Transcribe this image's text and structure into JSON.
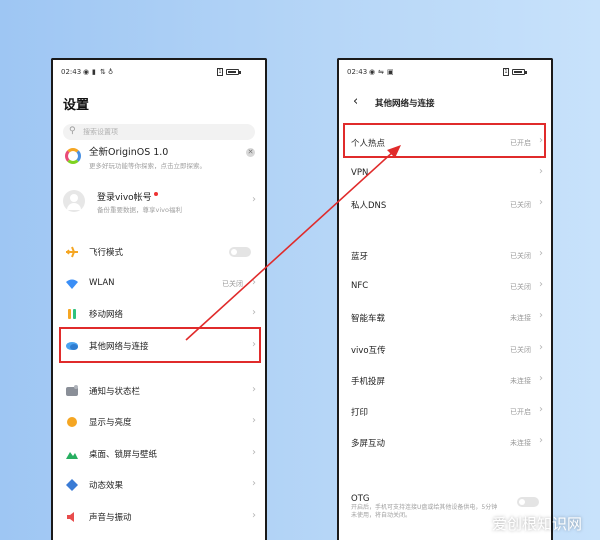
{
  "left": {
    "status": {
      "time": "02:43",
      "icons": [
        "eye-icon",
        "signal-icon",
        "data-icon",
        "location-icon"
      ],
      "battery": "battery-icon"
    },
    "title": "设置",
    "search_placeholder": "搜索设置项",
    "update": {
      "title": "全新OriginOS 1.0",
      "subtitle": "更多好玩功能等你探索，点击立即探索。"
    },
    "account": {
      "name": "登录vivo帐号",
      "sub": "备份重要数据，尊享vivo福利"
    },
    "items": [
      {
        "label": "飞行模式",
        "value": "",
        "icon": "airplane-icon",
        "color": "#f5a623"
      },
      {
        "label": "WLAN",
        "value": "已关闭",
        "icon": "wifi-icon",
        "color": "#3a8ef6"
      },
      {
        "label": "移动网络",
        "value": "",
        "icon": "cellular-icon",
        "color": "#2ec27e"
      },
      {
        "label": "其他网络与连接",
        "value": "",
        "icon": "connection-icon",
        "color": "#4aa3f0"
      },
      {
        "label": "通知与状态栏",
        "value": "",
        "icon": "notification-icon",
        "color": "#8a8f98"
      },
      {
        "label": "显示与亮度",
        "value": "",
        "icon": "brightness-icon",
        "color": "#f5a623"
      },
      {
        "label": "桌面、锁屏与壁纸",
        "value": "",
        "icon": "wallpaper-icon",
        "color": "#27ae60"
      },
      {
        "label": "动态效果",
        "value": "",
        "icon": "dynamic-effect-icon",
        "color": "#3a7bd5"
      },
      {
        "label": "声音与振动",
        "value": "",
        "icon": "sound-icon",
        "color": "#e84c4c"
      }
    ]
  },
  "right": {
    "status": {
      "time": "02:43",
      "icons": [
        "eye-icon",
        "signal-icon",
        "data-icon"
      ],
      "battery": "battery-icon"
    },
    "title": "其他网络与连接",
    "items": [
      {
        "label": "个人热点",
        "value": "已开启"
      },
      {
        "label": "VPN",
        "value": ""
      },
      {
        "label": "私人DNS",
        "value": "已关闭"
      },
      {
        "label": "蓝牙",
        "value": "已关闭"
      },
      {
        "label": "NFC",
        "value": "已关闭"
      },
      {
        "label": "智能车载",
        "value": "未连接"
      },
      {
        "label": "vivo互传",
        "value": "已关闭"
      },
      {
        "label": "手机投屏",
        "value": "未连接"
      },
      {
        "label": "打印",
        "value": "已开启"
      },
      {
        "label": "多屏互动",
        "value": "未连接"
      }
    ],
    "otg": {
      "label": "OTG",
      "sub": "开启后，手机可支持连接U盘或给其他设备供电，5分钟未使用，将自动关闭。"
    }
  },
  "watermark": "爱创根知识网",
  "colors": {
    "highlight": "#e02b2b",
    "background": "#a9cdf5"
  }
}
